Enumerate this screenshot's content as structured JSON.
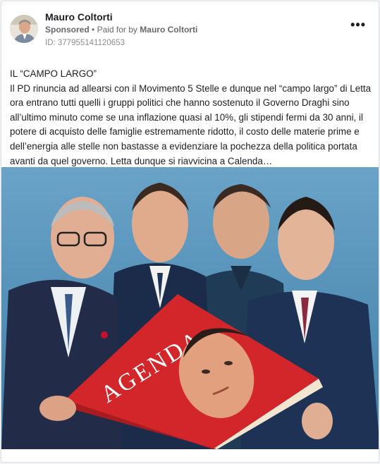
{
  "post": {
    "page_name": "Mauro Coltorti",
    "sponsored_label": "Sponsored",
    "separator": "•",
    "paid_for_prefix": "Paid for by",
    "paid_for_name": "Mauro Coltorti",
    "ad_id": "ID: 377955141120653",
    "more_options_icon": "more-horizontal-icon",
    "headline": "IL “CAMPO LARGO”",
    "body": "Il PD rinuncia ad allearsi con il Movimento 5 Stelle e dunque nel “campo largo” di Letta ora entrano tutti quelli i gruppi politici che hanno sostenuto il Governo Draghi sino all’ultimo minuto come se una inflazione quasi al 10%, gli stipendi fermi da 30 anni, il potere di acquisto delle famiglie estremamente ridotto, il costo delle materie prime e dell’energia alle stelle non bastasse a evidenziare la pochezza della politica portata avanti da quel governo. Letta dunque si riavvicina a Calenda…"
  },
  "media": {
    "book_title": "AGENDA"
  }
}
